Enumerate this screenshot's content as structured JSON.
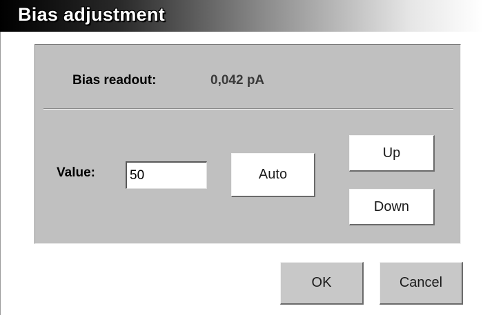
{
  "window": {
    "title": "Bias adjustment"
  },
  "readout": {
    "label": "Bias readout:",
    "value": "0,042 pA"
  },
  "value_field": {
    "label": "Value:",
    "value": "50"
  },
  "buttons": {
    "auto": "Auto",
    "up": "Up",
    "down": "Down",
    "ok": "OK",
    "cancel": "Cancel"
  },
  "colors": {
    "panel": "#c0c0c0",
    "dialog_background": "#ffffff",
    "button_face": "#ffffff",
    "footer_button_face": "#c8c8c8"
  }
}
